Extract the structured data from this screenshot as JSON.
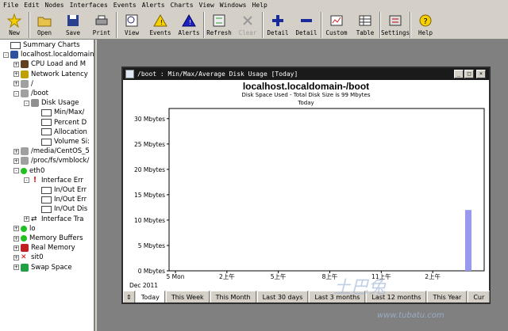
{
  "menu": [
    "File",
    "Edit",
    "Nodes",
    "Interfaces",
    "Events",
    "Alerts",
    "Charts",
    "View",
    "Windows",
    "Help"
  ],
  "toolbar": [
    {
      "label": "New",
      "icon": "new-star-icon",
      "enabled": true
    },
    {
      "label": "Open",
      "icon": "folder-open-icon",
      "enabled": true
    },
    {
      "label": "Save",
      "icon": "floppy-disk-icon",
      "enabled": true
    },
    {
      "label": "Print",
      "icon": "printer-icon",
      "enabled": true
    },
    {
      "label": "View",
      "icon": "magnifier-icon",
      "enabled": true
    },
    {
      "label": "Events",
      "icon": "warning-triangle-icon",
      "enabled": true
    },
    {
      "label": "Alerts",
      "icon": "alert-triangle-icon",
      "enabled": true
    },
    {
      "label": "Refresh",
      "icon": "refresh-icon",
      "enabled": true
    },
    {
      "label": "Clear",
      "icon": "clear-x-icon",
      "enabled": false
    },
    {
      "label": "Detail",
      "icon": "plus-icon",
      "enabled": true
    },
    {
      "label": "Detail",
      "icon": "minus-icon",
      "enabled": true
    },
    {
      "label": "Custom",
      "icon": "chart-icon",
      "enabled": true
    },
    {
      "label": "Table",
      "icon": "table-icon",
      "enabled": true
    },
    {
      "label": "Settings",
      "icon": "settings-icon",
      "enabled": true
    },
    {
      "label": "Help",
      "icon": "help-icon",
      "enabled": true
    }
  ],
  "tree": [
    {
      "label": "Summary Charts",
      "level": 0,
      "icon": "summary-chart-icon",
      "expander": ""
    },
    {
      "label": "localhost.localdomain",
      "level": 0,
      "icon": "host-icon",
      "expander": "-"
    },
    {
      "label": "CPU Load and M",
      "level": 1,
      "icon": "cpu-icon",
      "expander": "+"
    },
    {
      "label": "Network Latency",
      "level": 1,
      "icon": "speaker-icon",
      "expander": "+"
    },
    {
      "label": "/",
      "level": 1,
      "icon": "disk-icon",
      "expander": "+"
    },
    {
      "label": "/boot",
      "level": 1,
      "icon": "disk-icon",
      "expander": "-"
    },
    {
      "label": "Disk Usage",
      "level": 2,
      "icon": "disk-stack-icon",
      "expander": "-"
    },
    {
      "label": "Min/Max/",
      "level": 3,
      "icon": "chart-small-icon",
      "expander": ""
    },
    {
      "label": "Percent D",
      "level": 3,
      "icon": "chart-small-icon",
      "expander": ""
    },
    {
      "label": "Allocation",
      "level": 3,
      "icon": "chart-small-icon",
      "expander": ""
    },
    {
      "label": "Volume Si:",
      "level": 3,
      "icon": "chart-small-icon",
      "expander": ""
    },
    {
      "label": "/media/CentOS_5",
      "level": 1,
      "icon": "disk-icon",
      "expander": "+"
    },
    {
      "label": "/proc/fs/vmblock/",
      "level": 1,
      "icon": "disk-icon",
      "expander": "+"
    },
    {
      "label": "eth0",
      "level": 1,
      "icon": "green-dot-icon",
      "expander": "-"
    },
    {
      "label": "Interface Err",
      "level": 2,
      "icon": "red-exclamation-icon",
      "expander": "-"
    },
    {
      "label": "In/Out Err",
      "level": 3,
      "icon": "chart-small-icon",
      "expander": ""
    },
    {
      "label": "In/Out Err",
      "level": 3,
      "icon": "chart-small-icon",
      "expander": ""
    },
    {
      "label": "In/Out Dis",
      "level": 3,
      "icon": "chart-small-icon",
      "expander": ""
    },
    {
      "label": "Interface Tra",
      "level": 2,
      "icon": "arrows-icon",
      "expander": "+"
    },
    {
      "label": "lo",
      "level": 1,
      "icon": "green-dot-icon",
      "expander": "+"
    },
    {
      "label": "Memory Buffers",
      "level": 1,
      "icon": "green-dot-icon",
      "expander": "+"
    },
    {
      "label": "Real Memory",
      "level": 1,
      "icon": "memory-icon",
      "expander": "+"
    },
    {
      "label": "sit0",
      "level": 1,
      "icon": "red-x-icon",
      "expander": "+"
    },
    {
      "label": "Swap Space",
      "level": 1,
      "icon": "swap-icon",
      "expander": "+"
    }
  ],
  "window": {
    "title": "/boot : Min/Max/Average Disk Usage [Today]",
    "buttons": [
      "_",
      "□",
      "×"
    ]
  },
  "chart_data": {
    "type": "bar",
    "title": "localhost.localdomain-/boot",
    "subtitle": "Disk Space Used - Total Disk Size is 99 Mbytes",
    "period": "Today",
    "yticks": [
      "0 Mbytes",
      "5 Mbytes",
      "10 Mbytes",
      "15 Mbytes",
      "20 Mbytes",
      "25 Mbytes",
      "30 Mbytes"
    ],
    "ylim": [
      0,
      32
    ],
    "xticks": [
      "5 Mon",
      "2上午",
      "5上午",
      "8上午",
      "11上午",
      "2上午"
    ],
    "xlabel": "Dec 2011",
    "series": [
      {
        "values": [
          0,
          0,
          0,
          0,
          0,
          12
        ]
      }
    ],
    "bar_color": "#9999ee"
  },
  "tabs": [
    "Today",
    "This Week",
    "This Month",
    "Last 30 days",
    "Last 3 months",
    "Last 12 months",
    "This Year",
    "Cur"
  ],
  "active_tab": 0,
  "watermark": {
    "text": "土巴兔",
    "url": "www.tubatu.com"
  }
}
